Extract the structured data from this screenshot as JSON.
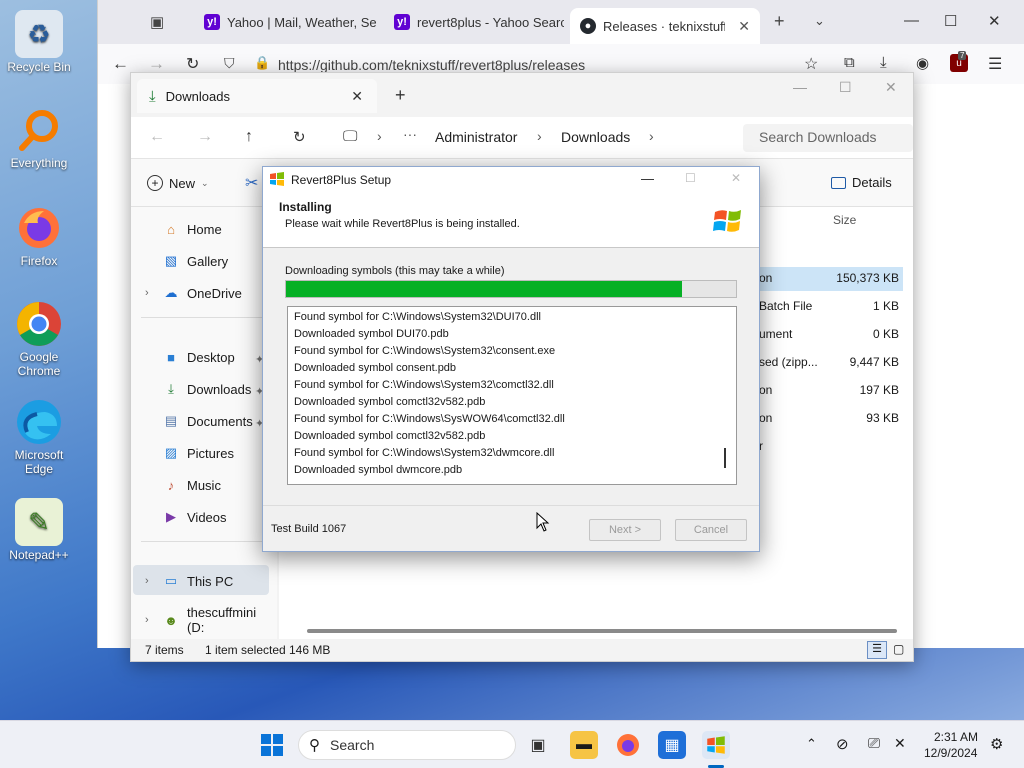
{
  "desktop": {
    "icons": [
      {
        "label": "Recycle Bin",
        "glyph": "🗑"
      },
      {
        "label": "Everything",
        "glyph": "⚲"
      },
      {
        "label": "Firefox",
        "glyph": "🦊"
      },
      {
        "label": "Google Chrome",
        "glyph": "◉"
      },
      {
        "label": "Microsoft Edge",
        "glyph": "◔"
      },
      {
        "label": "Notepad++",
        "glyph": "✎"
      }
    ]
  },
  "browser": {
    "tabs": [
      {
        "title": "Yahoo | Mail, Weather, Se",
        "icon": "yahoo-icon"
      },
      {
        "title": "revert8plus - Yahoo Searc",
        "icon": "yahoo-icon"
      },
      {
        "title": "Releases · teknixstuff/rev",
        "icon": "github-icon"
      }
    ],
    "url": "https://github.com/teknixstuff/revert8plus/releases",
    "extension_badge": "7"
  },
  "explorer": {
    "tab_title": "Downloads",
    "breadcrumb": [
      "Administrator",
      "Downloads"
    ],
    "search_placeholder": "Search Downloads",
    "new_label": "New",
    "details_label": "Details",
    "size_header": "Size",
    "sidebar": {
      "top": [
        "Home",
        "Gallery",
        "OneDrive"
      ],
      "pinned": [
        "Desktop",
        "Downloads",
        "Documents",
        "Pictures",
        "Music",
        "Videos"
      ],
      "bottom": [
        "This PC",
        "thescuffmini (D:"
      ]
    },
    "files": [
      {
        "name_fragment": "on",
        "size": "150,373 KB"
      },
      {
        "name_fragment": "Batch File",
        "size": "1 KB"
      },
      {
        "name_fragment": "ument",
        "size": "0 KB"
      },
      {
        "name_fragment": "sed (zipp...",
        "size": "9,447 KB"
      },
      {
        "name_fragment": "on",
        "size": "197 KB"
      },
      {
        "name_fragment": "on",
        "size": "93 KB"
      },
      {
        "name_fragment": "r",
        "size": ""
      }
    ],
    "status": {
      "items": "7 items",
      "selected": "1 item selected",
      "selected_size": "146 MB"
    }
  },
  "dialog": {
    "title": "Revert8Plus Setup",
    "heading": "Installing",
    "subheading": "Please wait while Revert8Plus is being installed.",
    "progress_label": "Downloading symbols (this may take a while)",
    "progress": 0.879,
    "log": [
      "Found symbol for C:\\Windows\\System32\\DUI70.dll",
      "Downloaded symbol DUI70.pdb",
      "Found symbol for C:\\Windows\\System32\\consent.exe",
      "Downloaded symbol consent.pdb",
      "Found symbol for C:\\Windows\\System32\\comctl32.dll",
      "Downloaded symbol comctl32v582.pdb",
      "Found symbol for C:\\Windows\\SysWOW64\\comctl32.dll",
      "Downloaded symbol comctl32v582.pdb",
      "Found symbol for C:\\Windows\\System32\\dwmcore.dll",
      "Downloaded symbol dwmcore.pdb"
    ],
    "footer": "Test Build 1067",
    "next_label": "Next >",
    "cancel_label": "Cancel"
  },
  "taskbar": {
    "search_placeholder": "Search",
    "time": "2:31 AM",
    "date": "12/9/2024"
  },
  "colors": {
    "progress": "#06b025",
    "accent": "#0067c0"
  }
}
